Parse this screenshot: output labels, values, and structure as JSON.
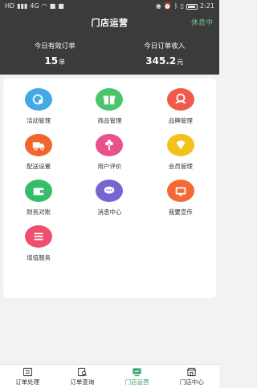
{
  "status": {
    "carrier": "HD",
    "signal": "4G",
    "time": "2:21"
  },
  "header": {
    "title": "门店运营",
    "rest_button": "休息中"
  },
  "stats": [
    {
      "label": "今日有效订单",
      "value": "15",
      "unit": "单"
    },
    {
      "label": "今日订单收入",
      "value": "345.2",
      "unit": "元"
    }
  ],
  "menu": [
    {
      "label": "活动管理",
      "color": "#41a9e6",
      "icon": "activity-icon"
    },
    {
      "label": "商品管理",
      "color": "#4cc46a",
      "icon": "gift-icon"
    },
    {
      "label": "品牌管理",
      "color": "#f05a4b",
      "icon": "brand-icon"
    },
    {
      "label": "配送设置",
      "color": "#f0662b",
      "icon": "truck-icon"
    },
    {
      "label": "用户评价",
      "color": "#e9518d",
      "icon": "flower-icon"
    },
    {
      "label": "会员管理",
      "color": "#f3c31b",
      "icon": "diamond-icon"
    },
    {
      "label": "财务对账",
      "color": "#35bd67",
      "icon": "wallet-icon"
    },
    {
      "label": "消息中心",
      "color": "#7a64d3",
      "icon": "message-icon"
    },
    {
      "label": "我要宣传",
      "color": "#f46a36",
      "icon": "tv-icon"
    },
    {
      "label": "增值服务",
      "color": "#ef4f6f",
      "icon": "list-icon"
    }
  ],
  "nav": [
    {
      "label": "订单处理",
      "icon": "order-process-icon",
      "active": false
    },
    {
      "label": "订单查询",
      "icon": "order-search-icon",
      "active": false
    },
    {
      "label": "门店运营",
      "icon": "store-ops-icon",
      "active": true
    },
    {
      "label": "门店中心",
      "icon": "store-center-icon",
      "active": false
    }
  ]
}
